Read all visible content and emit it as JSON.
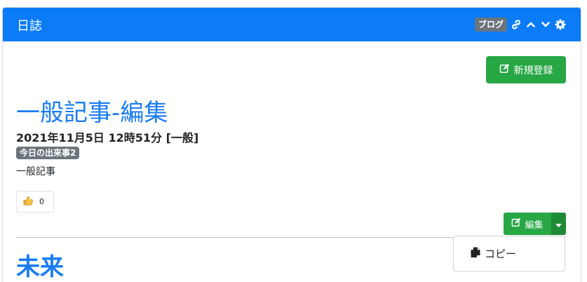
{
  "header": {
    "title": "日誌",
    "badge": "ブログ",
    "icons": [
      "link-icon",
      "chevron-up-icon",
      "chevron-down-icon",
      "gear-icon"
    ]
  },
  "toolbar": {
    "new_label": "新規登録"
  },
  "article": {
    "title": "一般記事-編集",
    "meta": "2021年11月5日 12時51分 [一般]",
    "tag": "今日の出来事2",
    "body": "一般記事",
    "likes": "0"
  },
  "actions": {
    "edit_label": "編集"
  },
  "dropdown": {
    "items": [
      {
        "label": "コピー",
        "icon": "copy-icon"
      }
    ]
  },
  "next_article": {
    "title": "未来"
  },
  "colors": {
    "header": "#0b7bf7",
    "success": "#28a745",
    "link": "#1a7cf2",
    "badge": "#6c757d"
  }
}
